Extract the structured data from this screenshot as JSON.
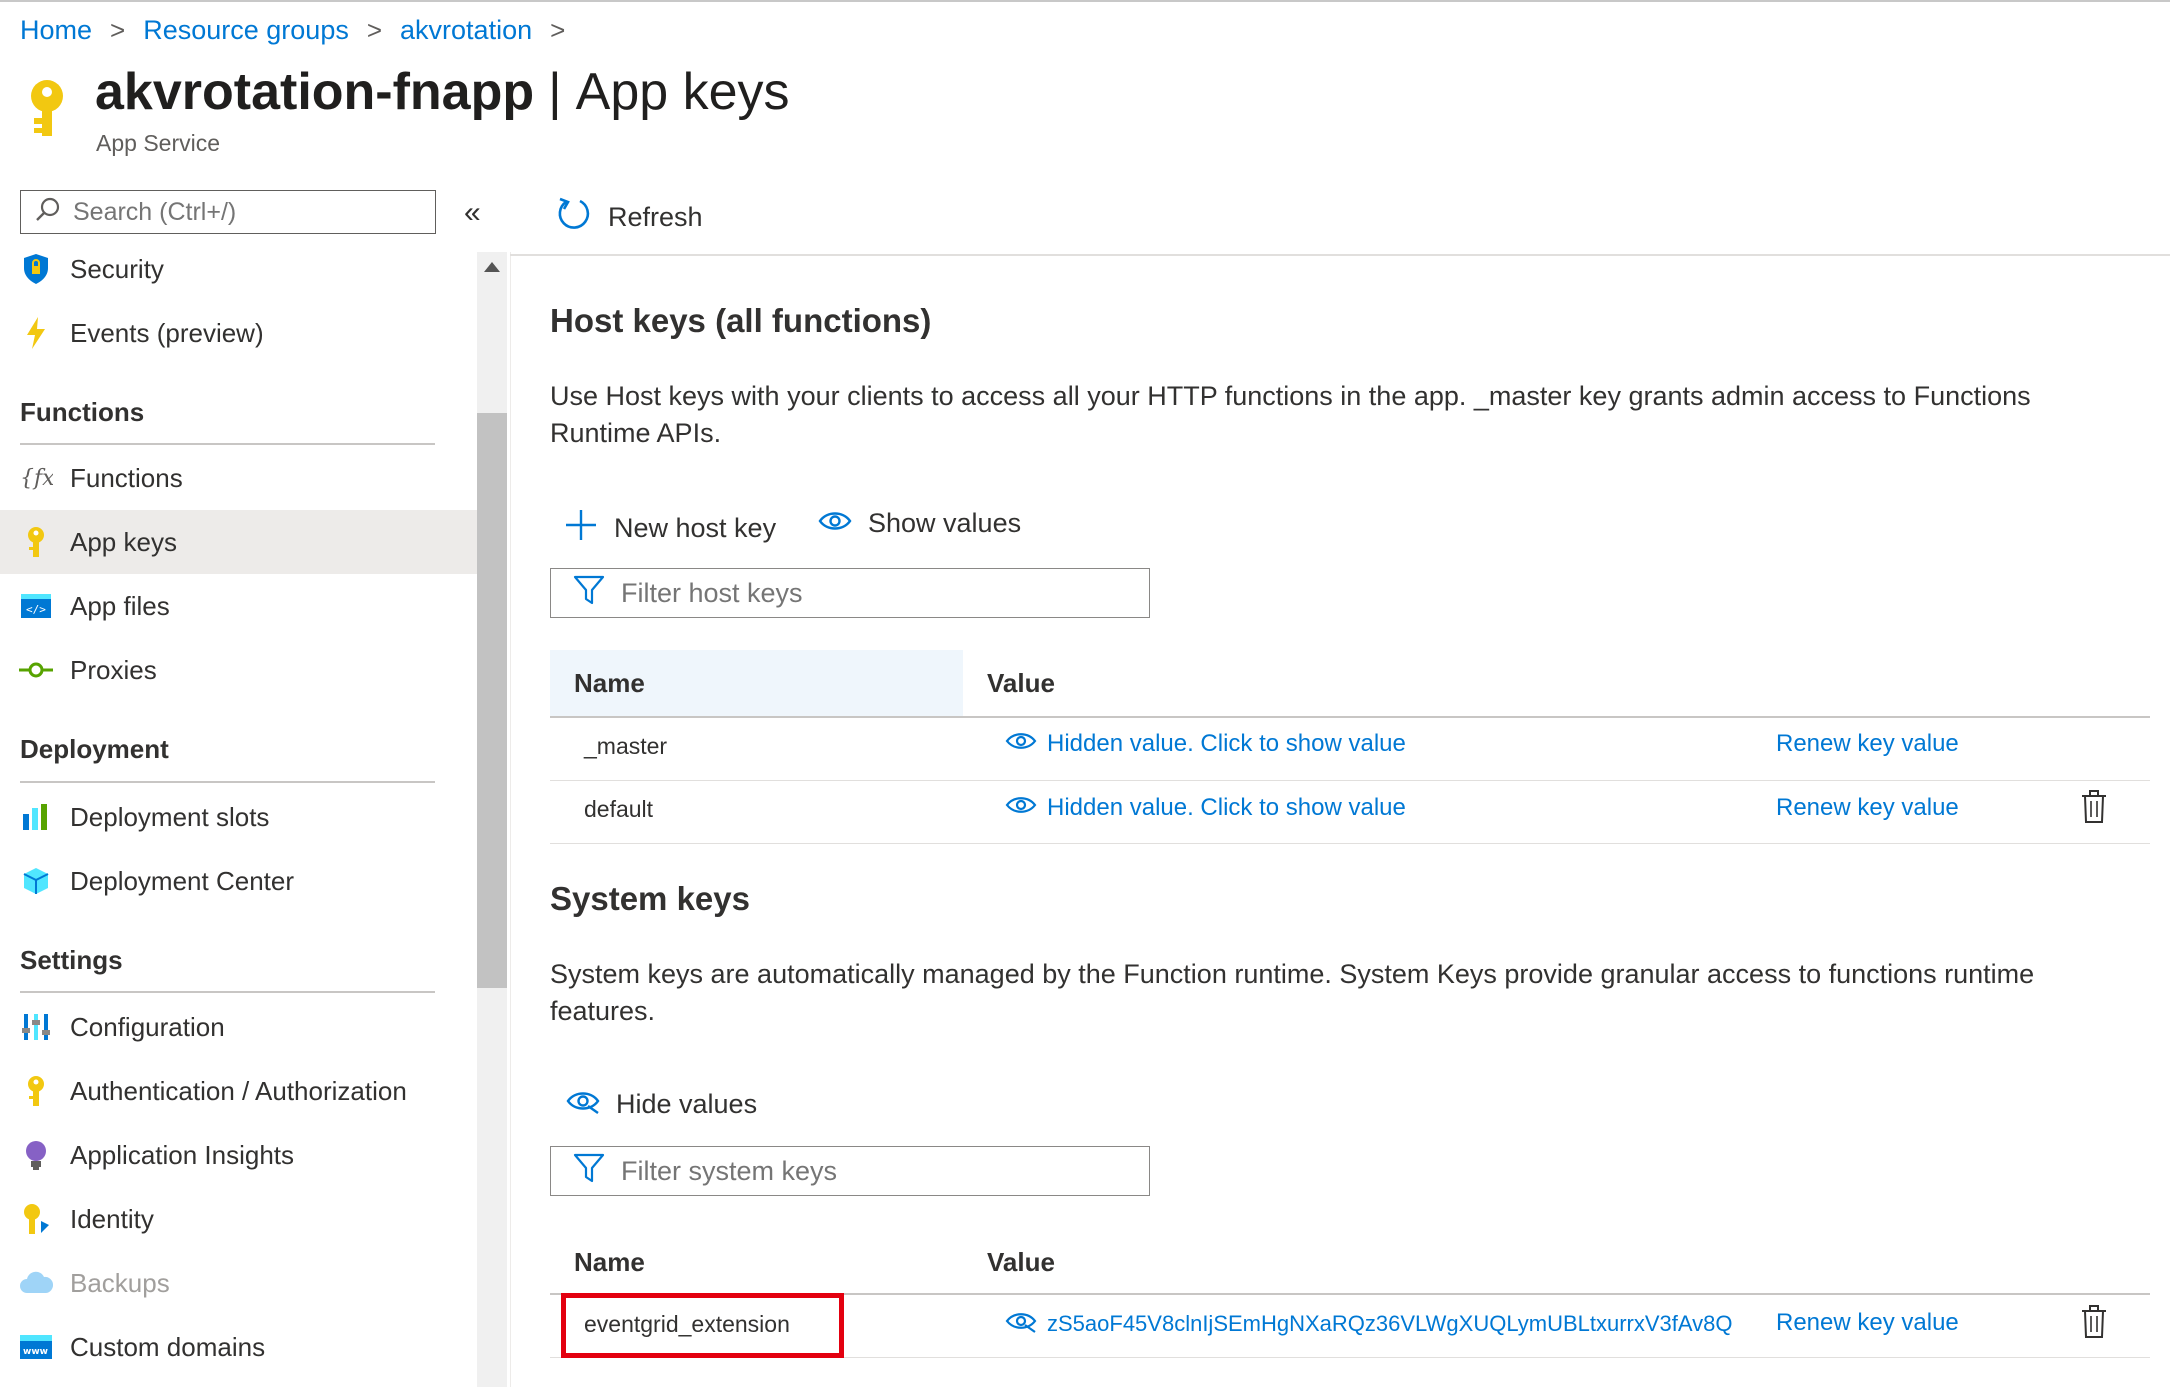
{
  "breadcrumb": {
    "items": [
      "Home",
      "Resource groups",
      "akvrotation"
    ],
    "separator": ">"
  },
  "header": {
    "resource_name": "akvrotation-fnapp",
    "page_name": "App keys",
    "pipe": "|",
    "subtitle": "App Service",
    "icon": "key-icon"
  },
  "sidebar": {
    "search_placeholder": "Search (Ctrl+/)",
    "collapse_glyph": "«",
    "items": {
      "security": "Security",
      "events": "Events (preview)",
      "functions": "Functions",
      "app_keys": "App keys",
      "app_files": "App files",
      "proxies": "Proxies",
      "deployment_slots": "Deployment slots",
      "deployment_center": "Deployment Center",
      "configuration": "Configuration",
      "auth": "Authentication / Authorization",
      "app_insights": "Application Insights",
      "identity": "Identity",
      "backups": "Backups",
      "custom_domains": "Custom domains"
    },
    "sections": {
      "functions": "Functions",
      "deployment": "Deployment",
      "settings": "Settings"
    },
    "selected": "App keys"
  },
  "toolbar": {
    "refresh_label": "Refresh"
  },
  "host_keys": {
    "title": "Host keys (all functions)",
    "description": "Use Host keys with your clients to access all your HTTP functions in the app. _master key grants admin access to Functions Runtime APIs.",
    "new_key_label": "New host key",
    "show_values_label": "Show values",
    "filter_placeholder": "Filter host keys",
    "columns": [
      "Name",
      "Value"
    ],
    "rows": [
      {
        "name": "_master",
        "value": "Hidden value. Click to show value",
        "renew": "Renew key value"
      },
      {
        "name": "default",
        "value": "Hidden value. Click to show value",
        "renew": "Renew key value"
      }
    ]
  },
  "system_keys": {
    "title": "System keys",
    "description": "System keys are automatically managed by the Function runtime. System Keys provide granular access to functions runtime features.",
    "hide_values_label": "Hide values",
    "filter_placeholder": "Filter system keys",
    "columns": [
      "Name",
      "Value"
    ],
    "rows": [
      {
        "name": "eventgrid_extension",
        "value": "zS5aoF45V8clnIjSEmHgNXaRQz36VLWgXUQLymUBLtxurrxV3fAv8Q",
        "renew": "Renew key value"
      }
    ]
  },
  "colors": {
    "link": "#0078d4",
    "highlight": "#e3000f",
    "selected_bg": "#edebe9",
    "key_yellow": "#f2c811"
  }
}
